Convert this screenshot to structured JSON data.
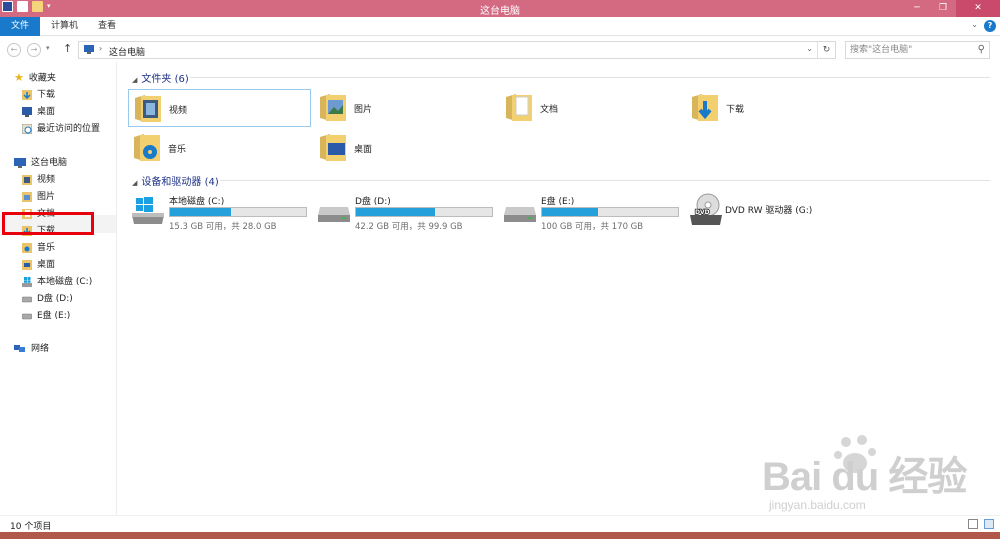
{
  "window": {
    "title": "这台电脑"
  },
  "ribbon": {
    "tabs": [
      "文件",
      "计算机",
      "查看"
    ]
  },
  "address": {
    "path": "这台电脑"
  },
  "search": {
    "placeholder": "搜索\"这台电脑\""
  },
  "sidebar": {
    "favorites": "收藏夹",
    "fav_items": [
      "下载",
      "桌面",
      "最近访问的位置"
    ],
    "this_pc": "这台电脑",
    "pc_items": [
      "视频",
      "图片",
      "文档",
      "下载",
      "音乐",
      "桌面",
      "本地磁盘 (C:)",
      "D盘 (D:)",
      "E盘 (E:)"
    ],
    "network": "网络"
  },
  "folders": {
    "header": "文件夹 (6)",
    "items": [
      "视频",
      "图片",
      "文档",
      "下载",
      "音乐",
      "桌面"
    ]
  },
  "drives": {
    "header": "设备和驱动器 (4)",
    "items": [
      {
        "name": "本地磁盘 (C:)",
        "free": "15.3 GB 可用，共 28.0 GB",
        "used_fraction": 0.45
      },
      {
        "name": "D盘 (D:)",
        "free": "42.2 GB 可用，共 99.9 GB",
        "used_fraction": 0.58
      },
      {
        "name": "E盘 (E:)",
        "free": "100 GB 可用，共 170 GB",
        "used_fraction": 0.41
      },
      {
        "name": "DVD RW 驱动器 (G:)"
      }
    ]
  },
  "status": {
    "count": "10 个项目"
  },
  "watermark": {
    "brand": "Bai du 经验",
    "url": "jingyan.baidu.com"
  }
}
